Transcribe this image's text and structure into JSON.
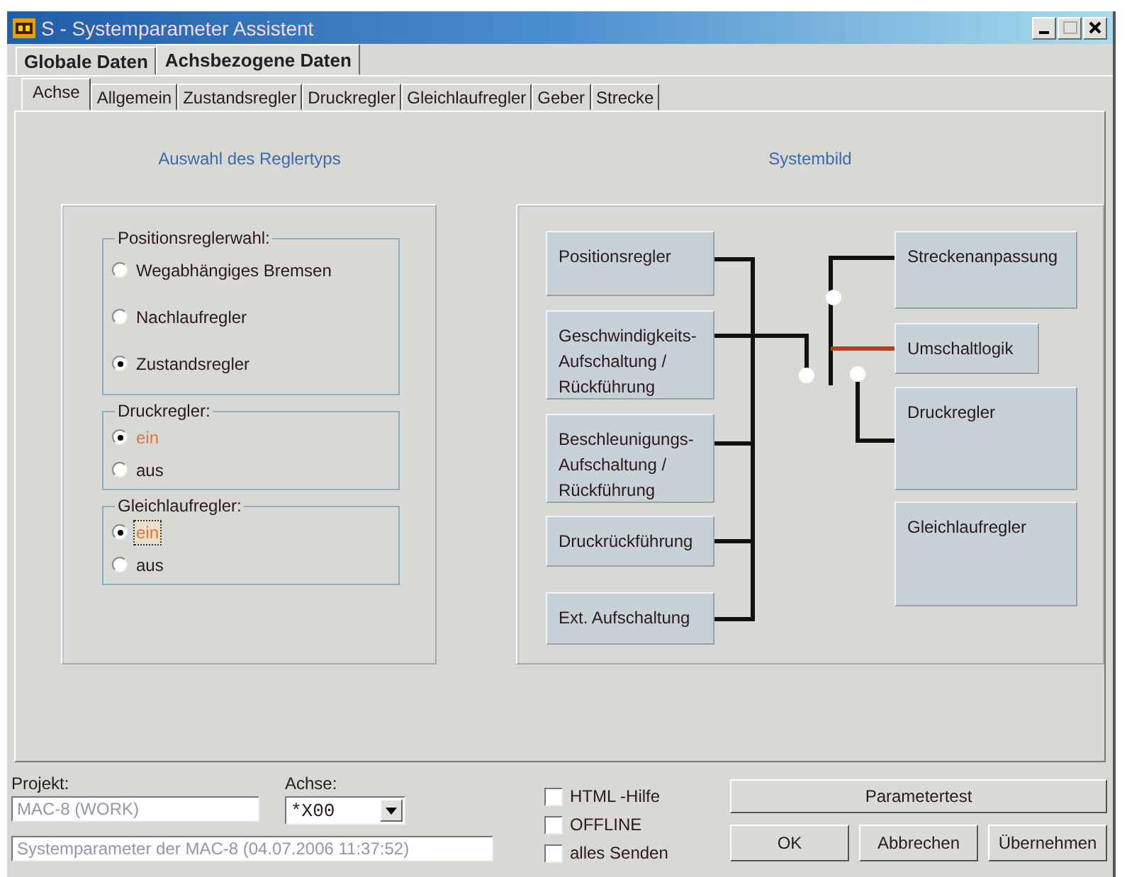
{
  "window": {
    "title": "S - Systemparameter Assistent"
  },
  "outer_tabs": [
    {
      "label": "Globale Daten",
      "selected": false
    },
    {
      "label": "Achsbezogene Daten",
      "selected": true
    }
  ],
  "inner_tabs": [
    {
      "label": "Achse",
      "selected": true
    },
    {
      "label": "Allgemein",
      "selected": false
    },
    {
      "label": "Zustandsregler",
      "selected": false
    },
    {
      "label": "Druckregler",
      "selected": false
    },
    {
      "label": "Gleichlaufregler",
      "selected": false
    },
    {
      "label": "Geber",
      "selected": false
    },
    {
      "label": "Strecke",
      "selected": false
    }
  ],
  "controller_selection": {
    "title": "Auswahl des Reglertyps",
    "groups": [
      {
        "title": "Positionsreglerwahl:",
        "options": [
          {
            "label": "Wegabhängiges Bremsen",
            "selected": false,
            "highlighted": false,
            "focused": false
          },
          {
            "label": "Nachlaufregler",
            "selected": false,
            "highlighted": false,
            "focused": false
          },
          {
            "label": "Zustandsregler",
            "selected": true,
            "highlighted": false,
            "focused": false
          }
        ]
      },
      {
        "title": "Druckregler:",
        "options": [
          {
            "label": "ein",
            "selected": true,
            "highlighted": true,
            "focused": false
          },
          {
            "label": "aus",
            "selected": false,
            "highlighted": false,
            "focused": false
          }
        ]
      },
      {
        "title": "Gleichlaufregler:",
        "options": [
          {
            "label": "ein",
            "selected": true,
            "highlighted": true,
            "focused": true
          },
          {
            "label": "aus",
            "selected": false,
            "highlighted": false,
            "focused": false
          }
        ]
      }
    ]
  },
  "system_image": {
    "title": "Systembild",
    "left_blocks": [
      {
        "label": "Positionsregler"
      },
      {
        "label": "Geschwindigkeits-Aufschaltung / Rückführung"
      },
      {
        "label": "Beschleunigungs-Aufschaltung / Rückführung"
      },
      {
        "label": "Druckrückführung"
      },
      {
        "label": "Ext. Aufschaltung"
      }
    ],
    "right_blocks": [
      {
        "label": "Streckenanpassung"
      },
      {
        "label": "Umschaltlogik"
      },
      {
        "label": "Druckregler"
      },
      {
        "label": "Gleichlaufregler"
      }
    ]
  },
  "footer": {
    "project_label": "Projekt:",
    "project_value": "MAC-8 (WORK)",
    "axis_label": "Achse:",
    "axis_value": "*X00",
    "description": "Systemparameter der MAC-8 (04.07.2006 11:37:52)",
    "checkboxes": [
      {
        "label": "HTML -Hilfe",
        "checked": false
      },
      {
        "label": "OFFLINE",
        "checked": false
      },
      {
        "label": "alles Senden",
        "checked": false
      }
    ],
    "buttons": [
      {
        "label": "Parametertest",
        "kind": "wide"
      },
      {
        "label": "OK",
        "kind": "normal"
      },
      {
        "label": "Abbrechen",
        "kind": "normal"
      },
      {
        "label": "Übernehmen",
        "kind": "normal"
      }
    ]
  }
}
